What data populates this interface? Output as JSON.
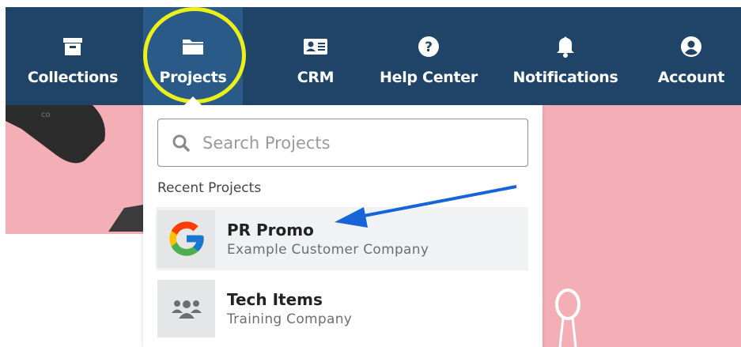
{
  "nav": {
    "items": [
      {
        "label": "Collections",
        "icon": "archive-icon"
      },
      {
        "label": "Projects",
        "icon": "folder-icon"
      },
      {
        "label": "CRM",
        "icon": "contact-card-icon"
      },
      {
        "label": "Help Center",
        "icon": "question-circle-icon"
      },
      {
        "label": "Notifications",
        "icon": "bell-icon"
      },
      {
        "label": "Account",
        "icon": "user-circle-icon"
      }
    ],
    "active": "Projects"
  },
  "dropdown": {
    "search_placeholder": "Search Projects",
    "recent_label": "Recent Projects",
    "projects": [
      {
        "title": "PR Promo",
        "subtitle": "Example Customer Company",
        "thumb_icon": "google-logo-icon"
      },
      {
        "title": "Tech Items",
        "subtitle": "Training Company",
        "thumb_icon": "group-icon"
      }
    ]
  },
  "colors": {
    "topbar": "#1f4467",
    "active_tab": "#2a5b88",
    "highlight_circle": "#ecf018",
    "arrow": "#1565d8",
    "background": "#f4afb6"
  }
}
